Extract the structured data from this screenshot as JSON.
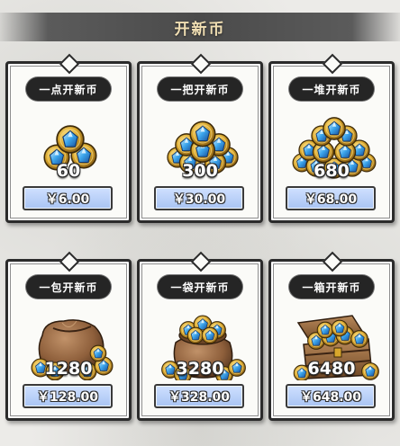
{
  "header": {
    "title": "开新币"
  },
  "packs": [
    {
      "name": "一点开新币",
      "amount": "60",
      "price": "￥6.00",
      "icon": "small-coin-stack"
    },
    {
      "name": "一把开新币",
      "amount": "300",
      "price": "￥30.00",
      "icon": "coin-handful"
    },
    {
      "name": "一堆开新币",
      "amount": "680",
      "price": "￥68.00",
      "icon": "coin-pile"
    },
    {
      "name": "一包开新币",
      "amount": "1280",
      "price": "￥128.00",
      "icon": "coin-pouch"
    },
    {
      "name": "一袋开新币",
      "amount": "3280",
      "price": "￥328.00",
      "icon": "coin-sack"
    },
    {
      "name": "一箱开新币",
      "amount": "6480",
      "price": "￥648.00",
      "icon": "treasure-chest"
    }
  ],
  "colors": {
    "coin_gold": "#d9a72c",
    "gem_blue": "#3ba5ec",
    "button_blue": "#a9c4f3",
    "tag_dark": "#252525",
    "header_text": "#f1dfb3"
  }
}
